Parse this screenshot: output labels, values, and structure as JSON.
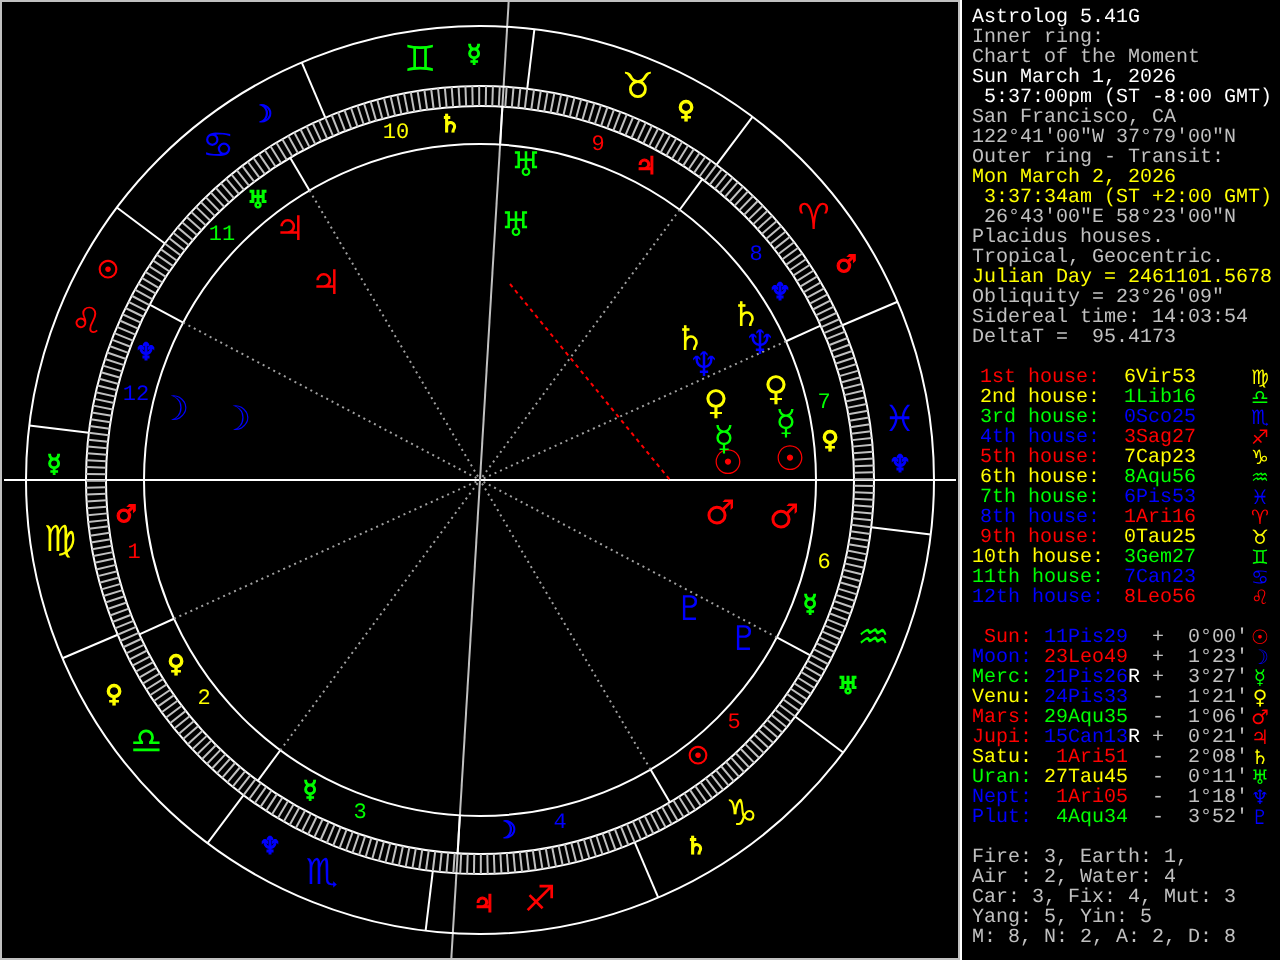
{
  "wheel": {
    "signs": [
      {
        "glyph": "♈",
        "color": "#ff0000"
      },
      {
        "glyph": "♉",
        "color": "#ffff00"
      },
      {
        "glyph": "♊",
        "color": "#00ff00"
      },
      {
        "glyph": "♋",
        "color": "#0000ff"
      },
      {
        "glyph": "♌",
        "color": "#ff0000"
      },
      {
        "glyph": "♍",
        "color": "#ffff00"
      },
      {
        "glyph": "♎",
        "color": "#00ff00"
      },
      {
        "glyph": "♏",
        "color": "#0000ff"
      },
      {
        "glyph": "♐",
        "color": "#ff0000"
      },
      {
        "glyph": "♑",
        "color": "#ffff00"
      },
      {
        "glyph": "♒",
        "color": "#00ff00"
      },
      {
        "glyph": "♓",
        "color": "#0000ff"
      }
    ],
    "house_numbers": [
      {
        "label": "1",
        "color": "#ff0000"
      },
      {
        "label": "2",
        "color": "#ffff00"
      },
      {
        "label": "3",
        "color": "#00ff00"
      },
      {
        "label": "4",
        "color": "#0000ff"
      },
      {
        "label": "5",
        "color": "#ff0000"
      },
      {
        "label": "6",
        "color": "#ffff00"
      },
      {
        "label": "7",
        "color": "#00ff00"
      },
      {
        "label": "8",
        "color": "#0000ff"
      },
      {
        "label": "9",
        "color": "#ff0000"
      },
      {
        "label": "10",
        "color": "#ffff00"
      },
      {
        "label": "11",
        "color": "#00ff00"
      },
      {
        "label": "12",
        "color": "#0000ff"
      }
    ],
    "planets": [
      {
        "glyph": "☉",
        "color": "#ff0000"
      },
      {
        "glyph": "☉",
        "color": "#ff0000"
      },
      {
        "glyph": "☽",
        "color": "#0000ff"
      },
      {
        "glyph": "☽",
        "color": "#0000ff"
      },
      {
        "glyph": "☿",
        "color": "#00ff00"
      },
      {
        "glyph": "☿",
        "color": "#00ff00"
      },
      {
        "glyph": "♀",
        "color": "#ffff00"
      },
      {
        "glyph": "♀",
        "color": "#ffff00"
      },
      {
        "glyph": "♂",
        "color": "#ff0000"
      },
      {
        "glyph": "♂",
        "color": "#ff0000"
      },
      {
        "glyph": "♃",
        "color": "#ff0000"
      },
      {
        "glyph": "♃",
        "color": "#ff0000"
      },
      {
        "glyph": "♄",
        "color": "#ffff00"
      },
      {
        "glyph": "♄",
        "color": "#ffff00"
      },
      {
        "glyph": "♅",
        "color": "#00ff00"
      },
      {
        "glyph": "♅",
        "color": "#00ff00"
      },
      {
        "glyph": "♆",
        "color": "#0000ff"
      },
      {
        "glyph": "♆",
        "color": "#0000ff"
      },
      {
        "glyph": "♇",
        "color": "#0000ff"
      },
      {
        "glyph": "♇",
        "color": "#0000ff"
      }
    ],
    "markers": [
      {
        "glyph": "☿",
        "color": "#00ff00"
      },
      {
        "glyph": "☽",
        "color": "#0000ff"
      },
      {
        "glyph": "♄",
        "color": "#ffff00"
      },
      {
        "glyph": "♀",
        "color": "#ffff00"
      },
      {
        "glyph": "♅",
        "color": "#00ff00"
      },
      {
        "glyph": "♃",
        "color": "#ff0000"
      },
      {
        "glyph": "☉",
        "color": "#ff0000"
      },
      {
        "glyph": "♆",
        "color": "#0000ff"
      },
      {
        "glyph": "♂",
        "color": "#ff0000"
      },
      {
        "glyph": "♆",
        "color": "#0000ff"
      },
      {
        "glyph": "☿",
        "color": "#00ff00"
      },
      {
        "glyph": "♀",
        "color": "#ffff00"
      },
      {
        "glyph": "♆",
        "color": "#0000ff"
      },
      {
        "glyph": "♂",
        "color": "#ff0000"
      },
      {
        "glyph": "☿",
        "color": "#00ff00"
      },
      {
        "glyph": "♀",
        "color": "#ffff00"
      },
      {
        "glyph": "♀",
        "color": "#ffff00"
      },
      {
        "glyph": "♅",
        "color": "#00ff00"
      },
      {
        "glyph": "☿",
        "color": "#00ff00"
      },
      {
        "glyph": "☉",
        "color": "#ff0000"
      },
      {
        "glyph": "♆",
        "color": "#0000ff"
      },
      {
        "glyph": "☽",
        "color": "#0000ff"
      },
      {
        "glyph": "♄",
        "color": "#ffff00"
      },
      {
        "glyph": "♃",
        "color": "#ff0000"
      }
    ]
  },
  "info": [
    {
      "text": "Astrolog 5.41G",
      "color": "#ffffff"
    },
    {
      "text": "Inner ring:",
      "color": "#c0c0c0"
    },
    {
      "text": "Chart of the Moment",
      "color": "#c0c0c0"
    },
    {
      "text": "Sun March 1, 2026",
      "color": "#ffffff"
    },
    {
      "text": " 5:37:00pm (ST -8:00 GMT)",
      "color": "#ffffff"
    },
    {
      "text": "San Francisco, CA",
      "color": "#c0c0c0"
    },
    {
      "text": "122°41'00\"W 37°79'00\"N",
      "color": "#c0c0c0"
    },
    {
      "text": "Outer ring - Transit:",
      "color": "#c0c0c0"
    },
    {
      "text": "Mon March 2, 2026",
      "color": "#ffff00"
    },
    {
      "text": " 3:37:34am (ST +2:00 GMT)",
      "color": "#ffff00"
    },
    {
      "text": " 26°43'00\"E 58°23'00\"N",
      "color": "#c0c0c0"
    },
    {
      "text": "Placidus houses.",
      "color": "#c0c0c0"
    },
    {
      "text": "Tropical, Geocentric.",
      "color": "#c0c0c0"
    },
    {
      "text": "Julian Day = 2461101.5678",
      "color": "#ffff00"
    },
    {
      "text": "Obliquity = 23°26'09\"",
      "color": "#c0c0c0"
    },
    {
      "text": "Sidereal time: 14:03:54",
      "color": "#c0c0c0"
    },
    {
      "text": "DeltaT =  95.4173",
      "color": "#c0c0c0"
    }
  ],
  "houses": [
    {
      "label": "1st house:",
      "color": "#ff0000",
      "position": {
        "text": "6Vir53",
        "color": "#ffff00"
      },
      "glyph": "♍"
    },
    {
      "label": "2nd house:",
      "color": "#ffff00",
      "position": {
        "text": "1Lib16",
        "color": "#00ff00"
      },
      "glyph": "♎"
    },
    {
      "label": "3rd house:",
      "color": "#00ff00",
      "position": {
        "text": "0Sco25",
        "color": "#0000ff"
      },
      "glyph": "♏"
    },
    {
      "label": "4th house:",
      "color": "#0000ff",
      "position": {
        "text": "3Sag27",
        "color": "#ff0000"
      },
      "glyph": "♐"
    },
    {
      "label": "5th house:",
      "color": "#ff0000",
      "position": {
        "text": "7Cap23",
        "color": "#ffff00"
      },
      "glyph": "♑"
    },
    {
      "label": "6th house:",
      "color": "#ffff00",
      "position": {
        "text": "8Aqu56",
        "color": "#00ff00"
      },
      "glyph": "♒"
    },
    {
      "label": "7th house:",
      "color": "#00ff00",
      "position": {
        "text": "6Pis53",
        "color": "#0000ff"
      },
      "glyph": "♓"
    },
    {
      "label": "8th house:",
      "color": "#0000ff",
      "position": {
        "text": "1Ari16",
        "color": "#ff0000"
      },
      "glyph": "♈"
    },
    {
      "label": "9th house:",
      "color": "#ff0000",
      "position": {
        "text": "0Tau25",
        "color": "#ffff00"
      },
      "glyph": "♉"
    },
    {
      "label": "10th house:",
      "color": "#ffff00",
      "position": {
        "text": "3Gem27",
        "color": "#00ff00"
      },
      "glyph": "♊"
    },
    {
      "label": "11th house:",
      "color": "#00ff00",
      "position": {
        "text": "7Can23",
        "color": "#0000ff"
      },
      "glyph": "♋"
    },
    {
      "label": "12th house:",
      "color": "#0000ff",
      "position": {
        "text": "8Leo56",
        "color": "#ff0000"
      },
      "glyph": "♌"
    }
  ],
  "planets": [
    {
      "name": "Sun:",
      "color": "#ff0000",
      "position": {
        "text": "11Pis29",
        "color": "#0000ff"
      },
      "retrograde": false,
      "sign": "+",
      "offset": "0°00'",
      "glyph": "☉"
    },
    {
      "name": "Moon:",
      "color": "#0000ff",
      "position": {
        "text": "23Leo49",
        "color": "#ff0000"
      },
      "retrograde": false,
      "sign": "+",
      "offset": "1°23'",
      "glyph": "☽"
    },
    {
      "name": "Merc:",
      "color": "#00ff00",
      "position": {
        "text": "21Pis26",
        "color": "#0000ff"
      },
      "retrograde": true,
      "retro_mark": "R",
      "sign": "+",
      "offset": "3°27'",
      "glyph": "☿"
    },
    {
      "name": "Venu:",
      "color": "#ffff00",
      "position": {
        "text": "24Pis33",
        "color": "#0000ff"
      },
      "retrograde": false,
      "sign": "-",
      "offset": "1°21'",
      "glyph": "♀"
    },
    {
      "name": "Mars:",
      "color": "#ff0000",
      "position": {
        "text": "29Aqu35",
        "color": "#00ff00"
      },
      "retrograde": false,
      "sign": "-",
      "offset": "1°06'",
      "glyph": "♂"
    },
    {
      "name": "Jupi:",
      "color": "#ff0000",
      "position": {
        "text": "15Can13",
        "color": "#0000ff"
      },
      "retrograde": true,
      "retro_mark": "R",
      "sign": "+",
      "offset": "0°21'",
      "glyph": "♃"
    },
    {
      "name": "Satu:",
      "color": "#ffff00",
      "position": {
        "text": "1Ari51",
        "color": "#ff0000"
      },
      "retrograde": false,
      "sign": "-",
      "offset": "2°08'",
      "glyph": "♄"
    },
    {
      "name": "Uran:",
      "color": "#00ff00",
      "position": {
        "text": "27Tau45",
        "color": "#ffff00"
      },
      "retrograde": false,
      "sign": "-",
      "offset": "0°11'",
      "glyph": "♅"
    },
    {
      "name": "Nept:",
      "color": "#0000ff",
      "position": {
        "text": "1Ari05",
        "color": "#ff0000"
      },
      "retrograde": false,
      "sign": "-",
      "offset": "1°18'",
      "glyph": "♆"
    },
    {
      "name": "Plut:",
      "color": "#0000ff",
      "position": {
        "text": "4Aqu34",
        "color": "#00ff00"
      },
      "retrograde": false,
      "sign": "-",
      "offset": "3°52'",
      "glyph": "♇"
    }
  ],
  "summary": [
    "Fire: 3, Earth: 1,",
    "Air : 2, Water: 4",
    "Car: 3, Fix: 4, Mut: 3",
    "Yang: 5, Yin: 5",
    "M: 8, N: 2, A: 2, D: 8"
  ]
}
